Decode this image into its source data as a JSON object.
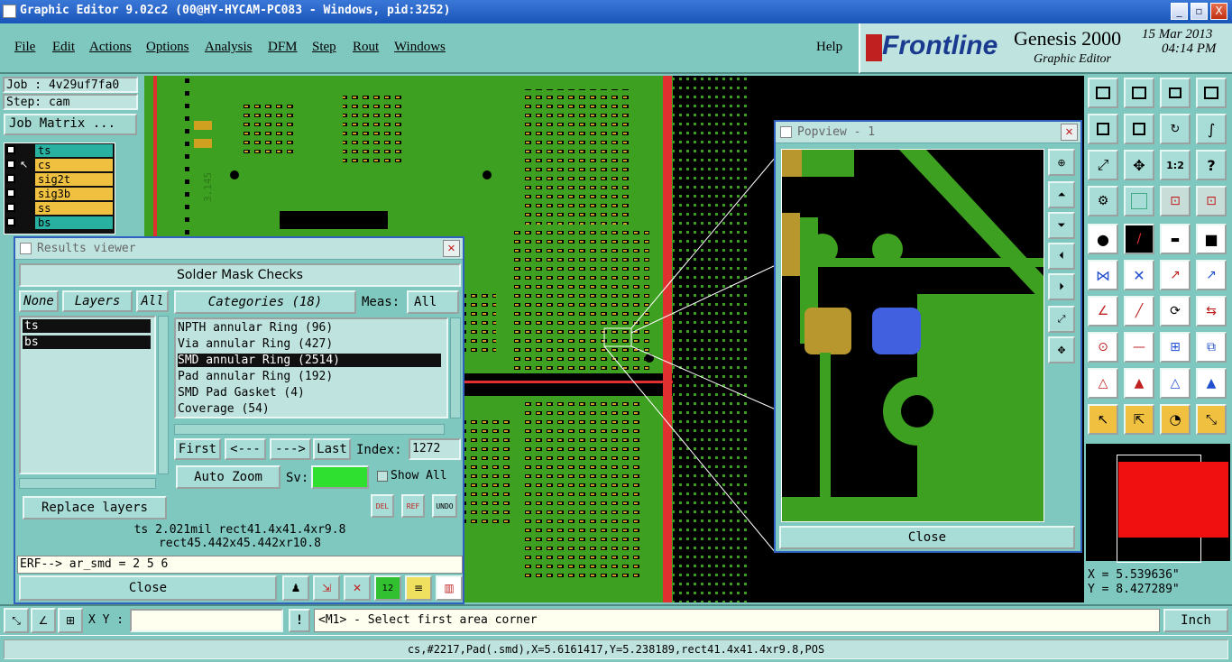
{
  "window": {
    "title": "Graphic Editor 9.02c2 (00@HY-HYCAM-PC083 - Windows, pid:3252)",
    "minimize": "_",
    "maximize": "▫",
    "close": "X"
  },
  "menu": {
    "items": [
      "File",
      "Edit",
      "Actions",
      "Options",
      "Analysis",
      "DFM",
      "Step",
      "Rout",
      "Windows"
    ],
    "help": "Help"
  },
  "brand": {
    "logo": "Frontline",
    "product": "Genesis 2000",
    "subtitle": "Graphic Editor",
    "date": "15 Mar 2013",
    "time": "04:14 PM"
  },
  "job": {
    "job_label": "Job : 4v29uf7fa0",
    "step_label": "Step: cam",
    "matrix_button": "Job Matrix ...",
    "layers": [
      {
        "name": "ts",
        "color": "#28b0a0"
      },
      {
        "name": "cs",
        "color": "#f0c040"
      },
      {
        "name": "sig2t",
        "color": "#f0c040"
      },
      {
        "name": "sig3b",
        "color": "#f0c040"
      },
      {
        "name": "ss",
        "color": "#f0c040"
      },
      {
        "name": "bs",
        "color": "#28b0a0"
      }
    ]
  },
  "results_viewer": {
    "title": "Results viewer",
    "header": "Solder Mask Checks",
    "none_btn": "None",
    "layers_btn": "Layers",
    "all_btn": "All",
    "layer_list": [
      "ts",
      "bs"
    ],
    "categories_btn": "Categories (18)",
    "meas_label": "Meas:",
    "meas_value": "All",
    "categories": [
      "NPTH annular Ring (96)",
      "Via annular Ring (427)",
      "SMD annular Ring (2514)",
      "Pad annular Ring (192)",
      "SMD Pad Gasket (4)",
      "Coverage (54)"
    ],
    "selected_category": 2,
    "nav": {
      "first": "First",
      "prev": "<---",
      "next": "--->",
      "last": "Last",
      "index_label": "Index:",
      "index_value": "1272"
    },
    "auto_zoom": "Auto Zoom",
    "sv_label": "Sv:",
    "show_all": "Show All",
    "replace_layers": "Replace layers",
    "del": "DEL",
    "ref": "REF",
    "undo": "UNDO",
    "measure_line1": "ts 2.021mil  rect41.4x41.4xr9.8",
    "measure_line2": "rect45.442x45.442xr10.8",
    "erf_line": "ERF--> ar_smd = 2 5 6",
    "close": "Close"
  },
  "popview": {
    "title": "Popview - 1",
    "close": "Close"
  },
  "coords": {
    "x": "X = 5.539636\"",
    "y": "Y = 8.427289\""
  },
  "command": {
    "xy_label": "X Y :",
    "xy_value": "",
    "bang": "!",
    "prompt": "<M1> - Select first area corner",
    "units": "Inch"
  },
  "status": "cs,#2217,Pad(.smd),X=5.6161417,Y=5.238189,rect41.4x41.4xr9.8,POS",
  "board_text": "3.145"
}
